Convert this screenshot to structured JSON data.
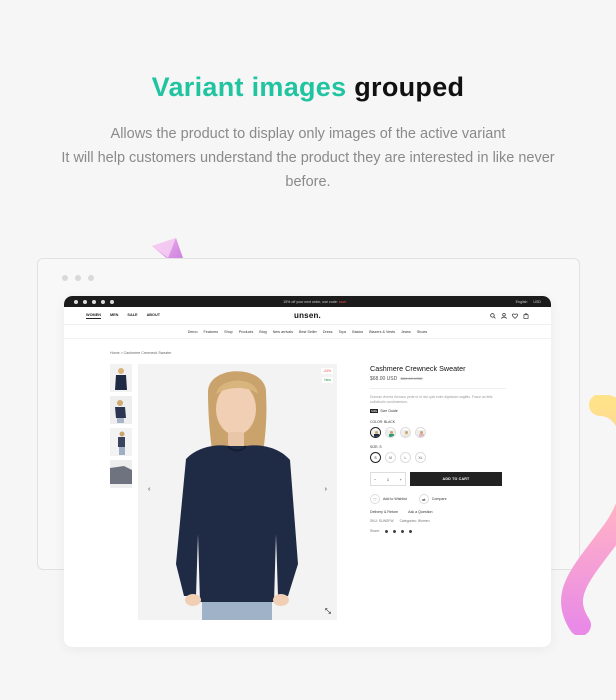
{
  "hero": {
    "title_accent": "Variant images",
    "title_rest": "grouped",
    "desc_line1": "Allows the product to display only images of the active variant",
    "desc_line2": "It will help customers understand the product they are interested in like never before."
  },
  "colors": {
    "accent": "#21c4a0",
    "topbar": "#1b1b1b",
    "sale": "#e24b4b",
    "sweater": "#1f2a44"
  },
  "store": {
    "promo": "15% off your next order, use code:",
    "promo_code": "save",
    "language": "English",
    "currency": "USD",
    "logo": "unsen.",
    "nav_left": [
      "WOMEN",
      "MEN",
      "SALE",
      "ABOUT"
    ],
    "menu": [
      "Demo",
      "Features",
      "Shop",
      "Products",
      "Blog",
      "New arrivals",
      "Best Seller",
      "Dress",
      "Tops",
      "Basics",
      "Blazers & Vests",
      "Jeans",
      "Shoes"
    ],
    "cart_count": "0",
    "wishlist_count": "0"
  },
  "breadcrumb": "Home > Cashmere Crewneck Sweater",
  "product": {
    "title": "Cashmere Crewneck Sweater",
    "price": "$68.00 USD",
    "old_price": "$89.00 USD",
    "description": "Donean viverra rhoncus pede ut id nisl quis enim dignissim sagittis. Fusce ac felis sollicitudin condimentum.",
    "size_guide_tag": "SIZE",
    "size_guide": "Size Guide",
    "color_label": "COLOR: BLACK",
    "size_label": "SIZE: S",
    "sizes": [
      "S",
      "M",
      "L",
      "XL"
    ],
    "qty_minus": "−",
    "qty_value": "1",
    "qty_plus": "+",
    "add_to_cart": "ADD TO CART",
    "wishlist": "Add to Wishlist",
    "compare": "Compare",
    "delivery": "Delivery & Return",
    "ask": "Ask a Question",
    "sku": "SKU: SUNSFW",
    "categories": "Categories: Women",
    "share": "Share:",
    "badge_sale": "-24%",
    "badge_new": "New",
    "prev_arrow": "‹",
    "next_arrow": "›"
  }
}
